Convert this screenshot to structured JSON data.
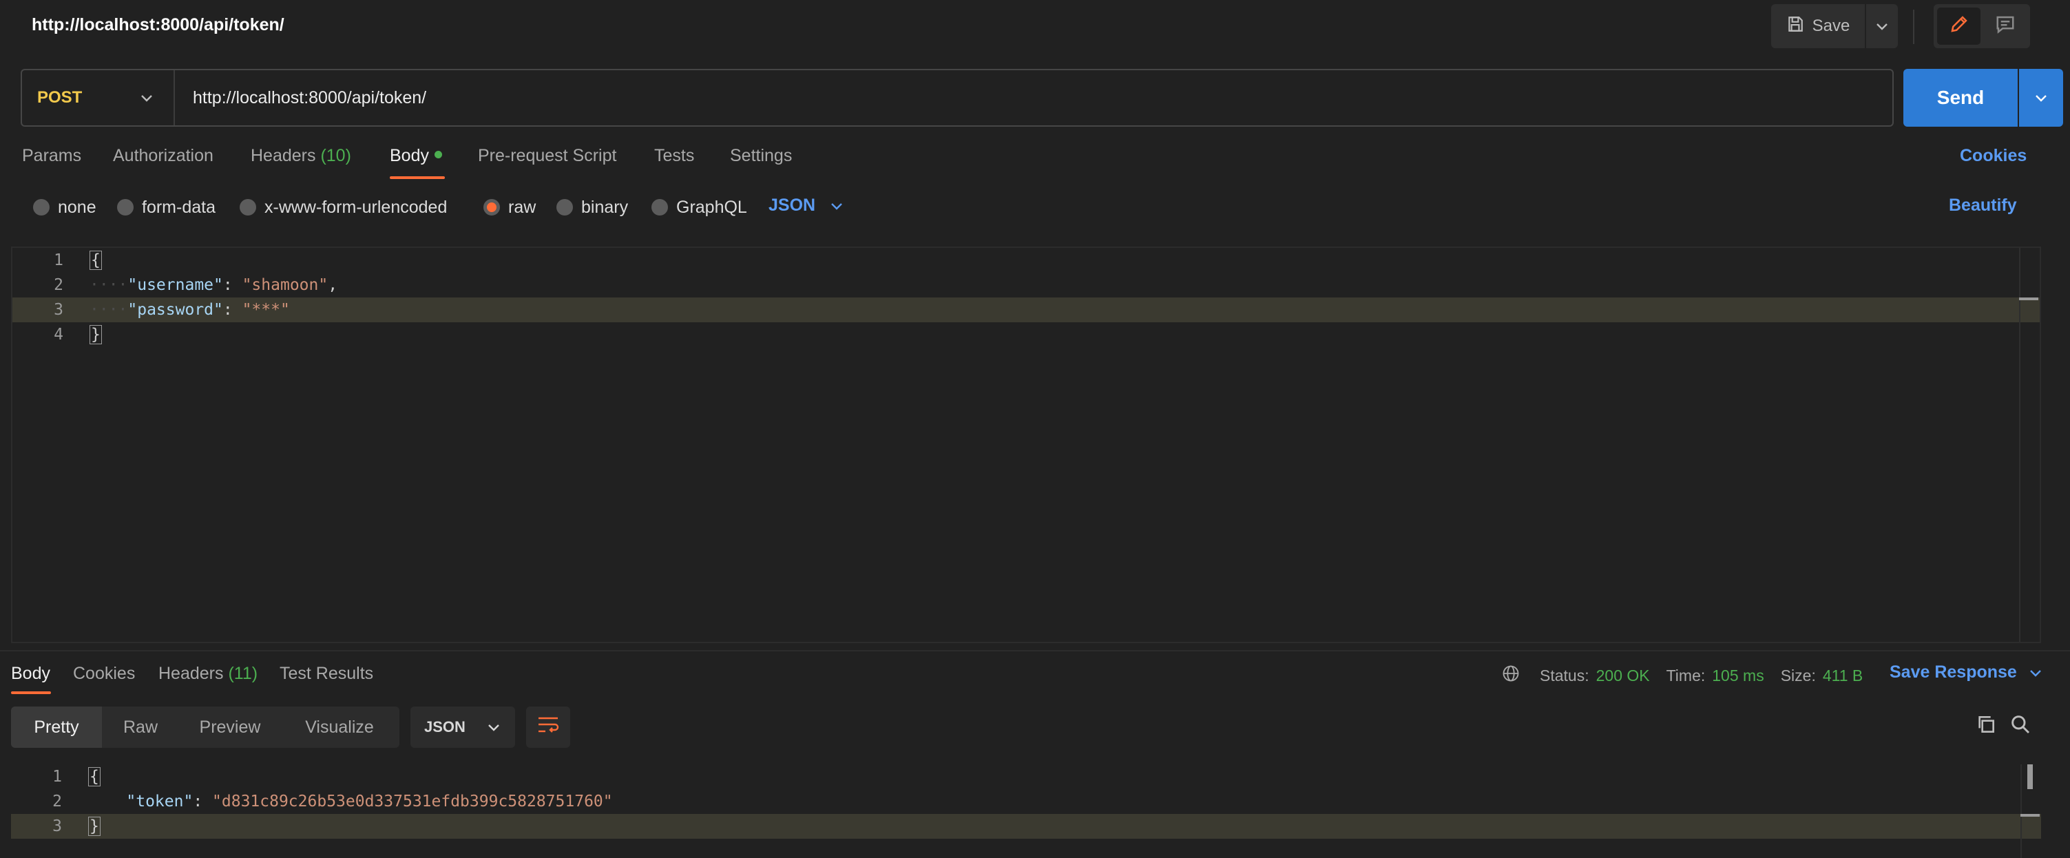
{
  "request": {
    "title": "http://localhost:8000/api/token/",
    "method": "POST",
    "url": "http://localhost:8000/api/token/"
  },
  "toolbar": {
    "save_label": "Save"
  },
  "send": {
    "label": "Send"
  },
  "tabs": {
    "params": "Params",
    "authorization": "Authorization",
    "headers": "Headers",
    "headers_count": "(10)",
    "body": "Body",
    "prerequest": "Pre-request Script",
    "tests": "Tests",
    "settings": "Settings",
    "cookies": "Cookies"
  },
  "body_types": {
    "none": "none",
    "form_data": "form-data",
    "urlencoded": "x-www-form-urlencoded",
    "raw": "raw",
    "binary": "binary",
    "graphql": "GraphQL",
    "selected": "raw",
    "format": "JSON",
    "beautify": "Beautify"
  },
  "request_body": {
    "line_numbers": [
      "1",
      "2",
      "3",
      "4"
    ],
    "open": "{",
    "username_key": "\"username\"",
    "username_val": "\"shamoon\"",
    "password_key": "\"password\"",
    "password_val": "\"***\"",
    "close": "}"
  },
  "response": {
    "tabs": {
      "body": "Body",
      "cookies": "Cookies",
      "headers": "Headers",
      "headers_count": "(11)",
      "test_results": "Test Results"
    },
    "status_label": "Status:",
    "status_value": "200 OK",
    "time_label": "Time:",
    "time_value": "105 ms",
    "size_label": "Size:",
    "size_value": "411 B",
    "save_response": "Save Response",
    "views": {
      "pretty": "Pretty",
      "raw": "Raw",
      "preview": "Preview",
      "visualize": "Visualize"
    },
    "format": "JSON",
    "body": {
      "line_numbers": [
        "1",
        "2",
        "3"
      ],
      "open": "{",
      "token_key": "\"token\"",
      "token_val": "\"d831c89c26b53e0d337531efdb399c5828751760\"",
      "close": "}"
    }
  },
  "colors": {
    "accent": "#ff6c37",
    "link": "#5b9bf2",
    "send": "#2d7cd6",
    "success": "#4caf50",
    "method": "#f2c94c"
  }
}
